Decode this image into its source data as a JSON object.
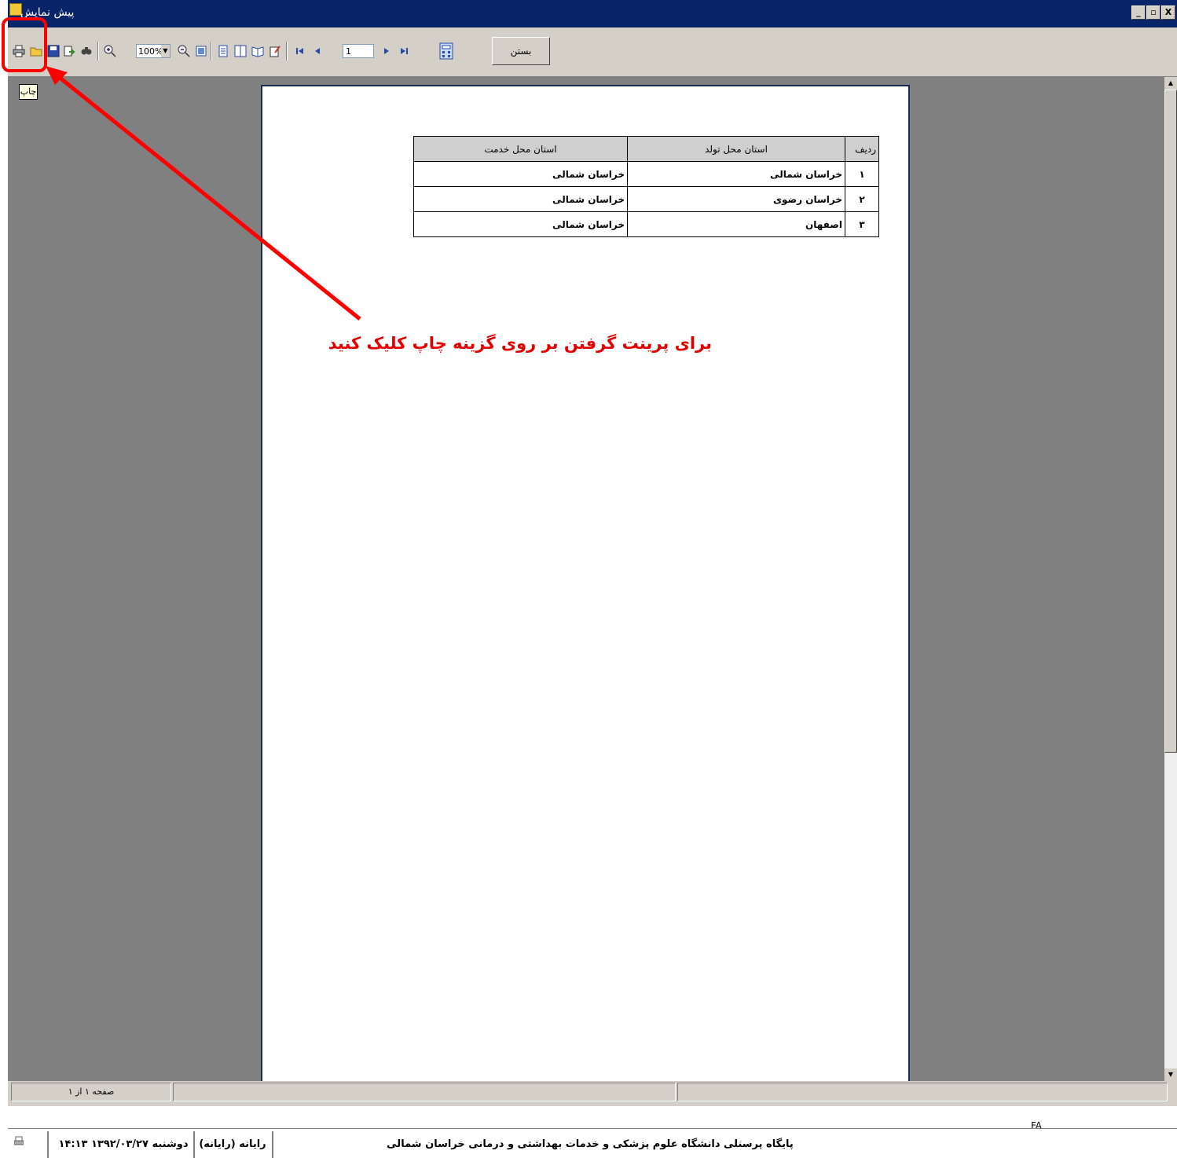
{
  "window": {
    "title": "پیش نمایش",
    "controls": {
      "minimize": "_",
      "restore": "▫",
      "close": "X"
    }
  },
  "toolbar": {
    "zoom_value": "100%",
    "page_value": "1",
    "close_label": "بستن",
    "icons": [
      "printer-icon",
      "open-folder-icon",
      "save-icon",
      "export-icon",
      "search-icon",
      "zoom-in-icon",
      "zoom-out-icon",
      "page-width-icon",
      "one-page-icon",
      "two-pages-icon",
      "book-icon",
      "edit-icon",
      "first-page-icon",
      "prev-page-icon",
      "next-page-icon",
      "last-page-icon",
      "calculator-icon"
    ]
  },
  "tooltip": {
    "text": "چاپ"
  },
  "report": {
    "headers": {
      "row": "ردیف",
      "birth": "استان محل تولد",
      "service": "استان محل خدمت"
    },
    "rows": [
      {
        "row": "۱",
        "birth": "خراسان شمالی",
        "service": "خراسان شمالی"
      },
      {
        "row": "۲",
        "birth": "خراسان رضوی",
        "service": "خراسان شمالی"
      },
      {
        "row": "۳",
        "birth": "اصفهان",
        "service": "خراسان شمالی"
      }
    ]
  },
  "annotation": {
    "text": "برای پرینت گرفتن بر روی گزینه چاپ کلیک کنید",
    "color": "#e00000"
  },
  "status": {
    "page_info": "صفحه ۱ از ۱",
    "lang": "FA",
    "datetime": "دوشنبه ۱۳۹۲/۰۳/۲۷  ۱۴:۱۳",
    "user": "رایانه (رایانه)",
    "org": "پایگاه پرسنلی دانشگاه علوم پزشکی و خدمات بهداشتی و درمانی خراسان شمالی"
  }
}
